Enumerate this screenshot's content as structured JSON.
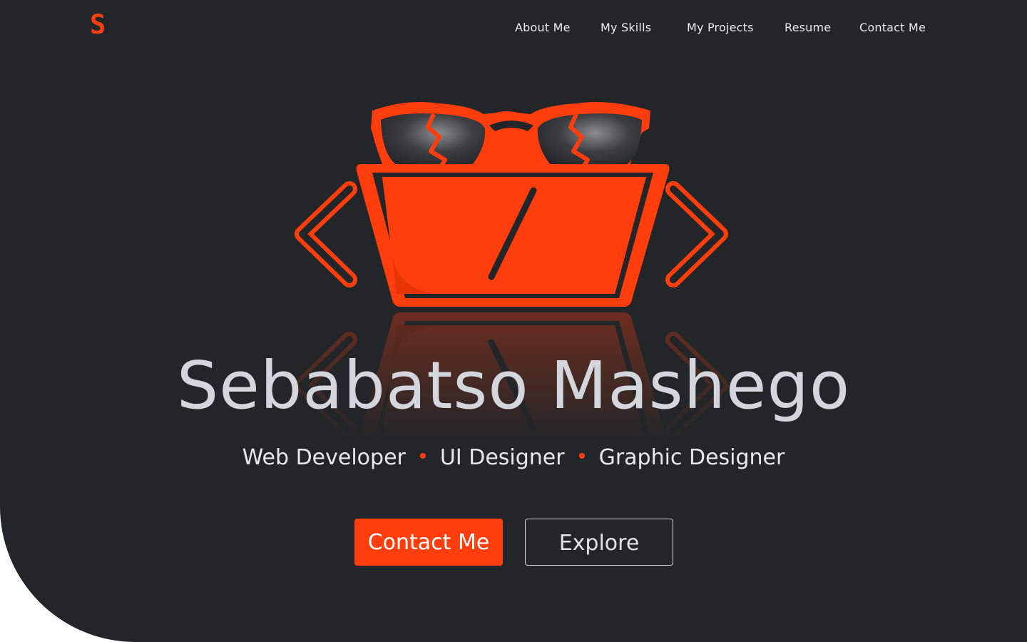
{
  "brand": {
    "logo_text": "S_",
    "accent_color": "#ff3d0d",
    "background_color": "#232629",
    "text_color": "#d4d6dd"
  },
  "nav": {
    "items": [
      {
        "label": "About Me"
      },
      {
        "label": "My Skills"
      },
      {
        "label": "My Projects"
      },
      {
        "label": "Resume"
      },
      {
        "label": "Contact Me"
      }
    ]
  },
  "hero": {
    "illustration": "glasses-laptop-code-brackets-icon",
    "name": "Sebabatso Mashego",
    "roles": [
      "Web Developer",
      "UI Designer",
      "Graphic Designer"
    ],
    "buttons": {
      "primary_label": "Contact Me",
      "secondary_label": "Explore"
    }
  }
}
